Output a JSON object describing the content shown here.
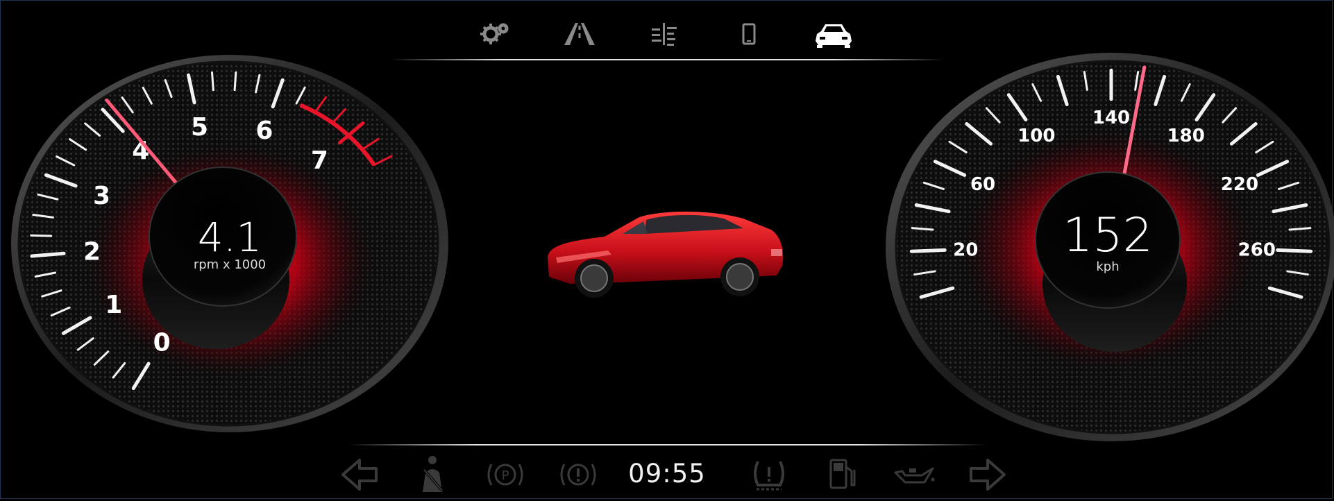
{
  "top_nav": [
    {
      "name": "settings",
      "icon": "gears-icon",
      "active": false
    },
    {
      "name": "road",
      "icon": "road-icon",
      "active": false
    },
    {
      "name": "media",
      "icon": "equalizer-icon",
      "active": false
    },
    {
      "name": "phone",
      "icon": "phone-icon",
      "active": false
    },
    {
      "name": "vehicle",
      "icon": "car-icon",
      "active": true
    }
  ],
  "tachometer": {
    "value": "4.1",
    "unit": "rpm x 1000",
    "scale_labels": [
      "0",
      "1",
      "2",
      "3",
      "4",
      "5",
      "6",
      "7"
    ],
    "reading": 4.1,
    "redline_start": 6.3
  },
  "speedometer": {
    "value": "152",
    "unit": "kph",
    "scale_labels": [
      "20",
      "60",
      "100",
      "140",
      "180",
      "220",
      "260"
    ],
    "reading": 152
  },
  "status_bar": {
    "time": "09:55",
    "indicators": [
      "left-turn-icon",
      "seatbelt-icon",
      "parking-brake-icon",
      "brake-warning-icon",
      "tire-pressure-icon",
      "fuel-icon",
      "oil-pressure-icon",
      "right-turn-icon"
    ]
  },
  "colors": {
    "accent": "#e8142a",
    "needle": "#ff5b78",
    "icon_dim": "#3a3a3a",
    "icon_active": "#ffffff"
  }
}
